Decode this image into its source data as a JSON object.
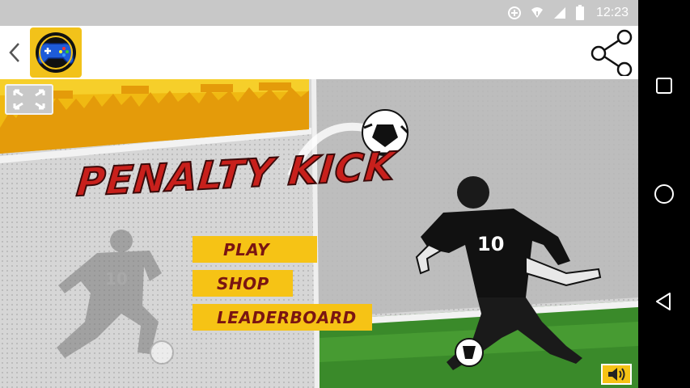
{
  "status_bar": {
    "time": "12:23"
  },
  "app_bar": {
    "icons": [
      "back-chevron-icon",
      "gamepad-app-icon",
      "share-icon"
    ]
  },
  "game": {
    "title": "PENALTY KICK",
    "menu": [
      "PLAY",
      "SHOP",
      "LEADERBOARD"
    ],
    "player_number": "10",
    "icons": [
      "fullscreen-icon",
      "speaker-icon",
      "soccer-ball-icon"
    ]
  },
  "nav_bar": {
    "icons": [
      "recent-apps-icon",
      "home-icon",
      "back-icon"
    ]
  },
  "colors": {
    "accent_yellow": "#f6c315",
    "title_red": "#c8201c",
    "field_green": "#3a8a2a"
  }
}
